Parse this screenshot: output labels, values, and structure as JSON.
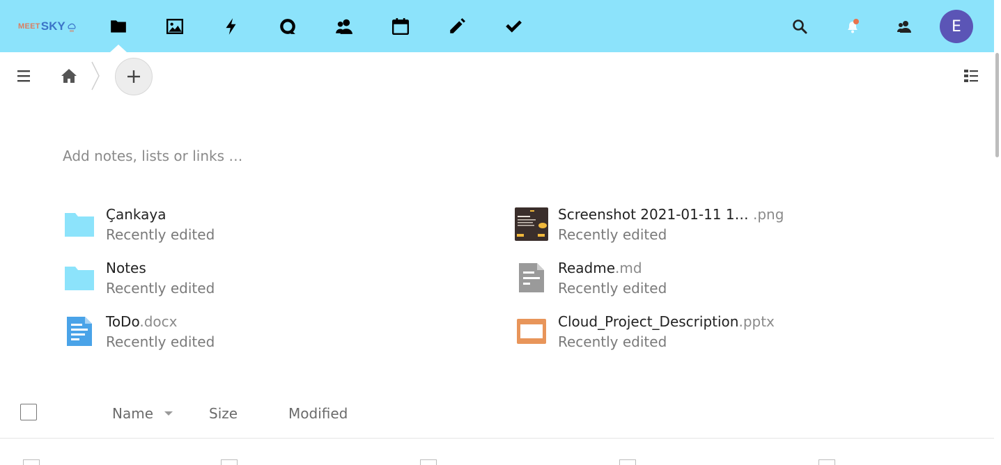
{
  "header": {
    "logo": {
      "meet": "MEET",
      "sky": "SKY"
    },
    "apps": [
      {
        "name": "Files",
        "icon": "folder-icon"
      },
      {
        "name": "Photos",
        "icon": "image-icon"
      },
      {
        "name": "Activity",
        "icon": "lightning-icon"
      },
      {
        "name": "Talk",
        "icon": "chat-bubble-icon"
      },
      {
        "name": "Contacts",
        "icon": "contacts-icon"
      },
      {
        "name": "Calendar",
        "icon": "calendar-icon"
      },
      {
        "name": "Notes",
        "icon": "pencil-icon"
      },
      {
        "name": "Tasks",
        "icon": "checkmark-icon"
      }
    ],
    "active_app": "Files",
    "avatar_initial": "E",
    "colors": {
      "header_bg": "#8ce3fb",
      "avatar_bg": "#5b55b6",
      "notification_dot": "#e9734c"
    }
  },
  "notes": {
    "placeholder": "Add notes, lists or links …"
  },
  "recent": [
    {
      "name": "Çankaya",
      "ext": "",
      "subtitle": "Recently edited",
      "icon": "folder-icon"
    },
    {
      "name": "Screenshot 2021-01-11 1…",
      "ext": " .png",
      "subtitle": "Recently edited",
      "icon": "image-thumbnail"
    },
    {
      "name": "Notes",
      "ext": "",
      "subtitle": "Recently edited",
      "icon": "folder-icon"
    },
    {
      "name": "Readme",
      "ext": ".md",
      "subtitle": "Recently edited",
      "icon": "text-document-icon"
    },
    {
      "name": "ToDo",
      "ext": ".docx",
      "subtitle": "Recently edited",
      "icon": "word-document-icon"
    },
    {
      "name": "Cloud_Project_Description",
      "ext": ".pptx",
      "subtitle": "Recently edited",
      "icon": "presentation-icon"
    }
  ],
  "table": {
    "columns": {
      "name": "Name",
      "size": "Size",
      "modified": "Modified"
    }
  },
  "colors": {
    "folder": "#8ce3fb",
    "doc_blue": "#4aa3e8",
    "doc_grey": "#9a9a9a",
    "pptx_orange": "#e8955a"
  }
}
